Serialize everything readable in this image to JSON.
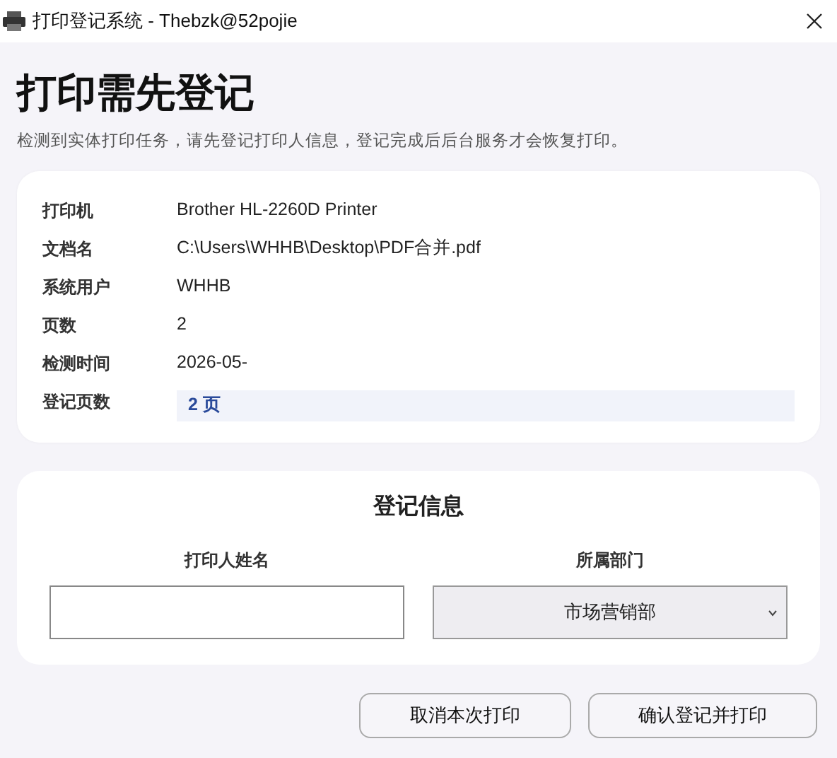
{
  "window": {
    "title": "打印登记系统 - Thebzk@52pojie"
  },
  "heading": "打印需先登记",
  "subtitle": "检测到实体打印任务，请先登记打印人信息，登记完成后后台服务才会恢复打印。",
  "details": [
    {
      "label": "打印机",
      "value": "Brother HL-2260D Printer",
      "kind": "plain"
    },
    {
      "label": "文档名",
      "value": "C:\\Users\\WHHB\\Desktop\\PDF合并.pdf",
      "kind": "plain"
    },
    {
      "label": "系统用户",
      "value": "WHHB",
      "kind": "plain"
    },
    {
      "label": "页数",
      "value": "2",
      "kind": "plain"
    },
    {
      "label": "检测时间",
      "value": "2026-05-",
      "kind": "plain"
    },
    {
      "label": "登记页数",
      "value": "2 页",
      "kind": "highlight"
    }
  ],
  "form": {
    "title": "登记信息",
    "name_label": "打印人姓名",
    "department_label": "所属部门",
    "department_value": "市场营销部"
  },
  "buttons": [
    "取消本次打印",
    "确认登记并打印"
  ]
}
